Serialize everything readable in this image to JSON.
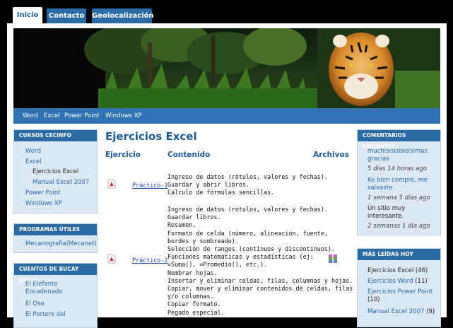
{
  "tabs": [
    "Inicio",
    "Contacto",
    "Geolocalización"
  ],
  "nav": [
    "Word",
    "Excel",
    "Power Point",
    "Windows XP"
  ],
  "left": {
    "cursos": {
      "title": "CURSOS CECINFO",
      "items": [
        "Word",
        "Excel",
        "Ejercicios Excel",
        "Manual Excel 2007",
        "Power Point",
        "Windows XP"
      ]
    },
    "programas": {
      "title": "PROGRAMAS ÚTILES",
      "items": [
        "Mecanografia(Mecanet)"
      ]
    },
    "cuentos": {
      "title": "CUENTOS DE BUCAY JORGE",
      "items": [
        "El Elefante Encadenado",
        "El Oso",
        "El Portero del"
      ]
    }
  },
  "main": {
    "title": "Ejercicios Excel",
    "col_ejercicio": "Ejercicio",
    "col_contenido": "Contenido",
    "col_archivos": "Archivos",
    "rows": [
      {
        "link": "Práctico-1",
        "content": "Ingreso de datos (rótulos, valores y fechas).\nGuardar y abrir libros.\nCálculo de fórmulas sencillas."
      },
      {
        "link": "Práctico-2",
        "content": "Ingreso de datos (rótulos, valores y fechas).\nGuardar libros.\nResumen.\nFormato de celda (número, alineación, fuente,\nbordes y sombreado).\nSelección de rangos (continuos y discontinuos).\nFunciones matemáticas y estadísticas (ej:\n=Suma(), =Promedio(), etc.).\nNombrar hojas.\nInsertar y eliminar celdas, filas, columnas y hojas.\nCopiar, mover y eliminar contenidos de celdas, filas\ny/o columnas.\nCopiar formato.\nPegado especial."
      }
    ]
  },
  "right": {
    "comentarios": {
      "title": "COMENTARIOS RECIENTES",
      "items": [
        {
          "text": "muchisisisisisisimas gracias",
          "time": "5 días 14 horas ago"
        },
        {
          "text": "Ke bien compre, me salvaste",
          "time": "1 semana 5 días ago"
        },
        {
          "text": "Un sitio muy interesante.",
          "time": "2 semanas 1 día ago"
        }
      ]
    },
    "leidas": {
      "title": "MÁS LEÍDAS HOY",
      "items": [
        {
          "label": "Ejercicios Excel",
          "count": "(46)"
        },
        {
          "label": "Ejercicios Word",
          "count": "(11)"
        },
        {
          "label": "Ejercicios Power Point",
          "count": "(10)"
        },
        {
          "label": "Manual Excel 2007",
          "count": "(9)"
        }
      ]
    }
  },
  "icons": {
    "pdf": "pdf-icon",
    "archive": "archive-icon"
  }
}
